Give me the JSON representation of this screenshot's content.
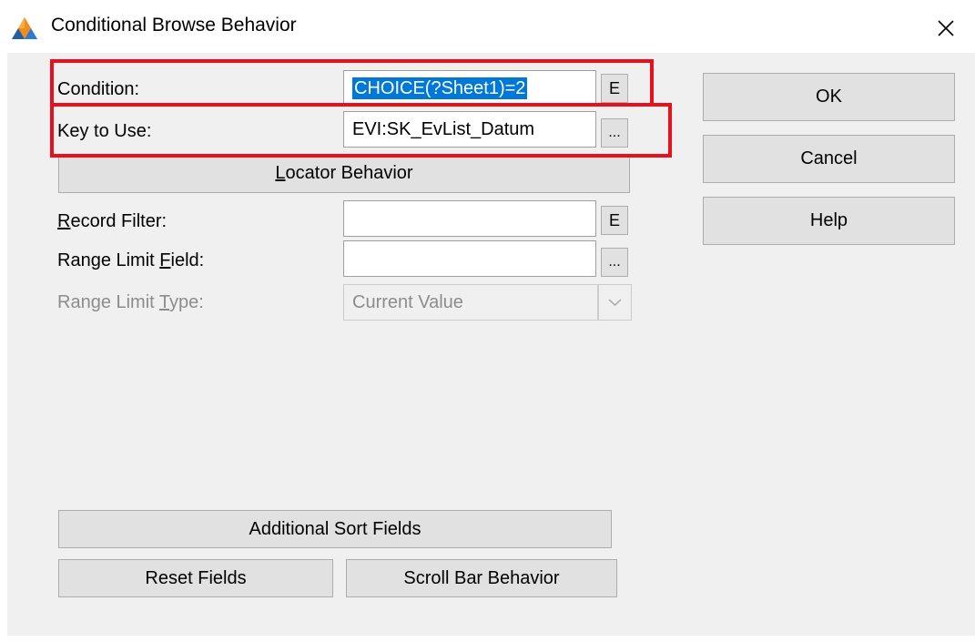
{
  "window": {
    "title": "Conditional Browse Behavior",
    "app_icon": "clarion-triangle-icon",
    "close_glyph": "✕"
  },
  "form": {
    "condition": {
      "label": "Condition:",
      "value": "CHOICE(?Sheet1)=2",
      "button_label": "E"
    },
    "key_to_use": {
      "label": "Key to Use:",
      "value": "EVI:SK_EvList_Datum",
      "button_label": "..."
    },
    "locator_behavior": {
      "label_accel": "L",
      "label_rest": "ocator Behavior"
    },
    "record_filter": {
      "label_accel": "R",
      "label_rest": "ecord Filter:",
      "value": "",
      "button_label": "E"
    },
    "range_limit_field": {
      "label_pre": "Range Limit ",
      "label_accel": "F",
      "label_rest": "ield:",
      "value": "",
      "button_label": "..."
    },
    "range_limit_type": {
      "label_pre": "Range Limit ",
      "label_accel": "T",
      "label_rest": "ype:",
      "selected_value": "Current Value",
      "enabled": false
    }
  },
  "buttons": {
    "ok": "OK",
    "cancel": "Cancel",
    "help": "Help",
    "additional_sort_fields": "Additional Sort Fields",
    "reset_fields": "Reset Fields",
    "scroll_bar_behavior": "Scroll Bar Behavior"
  },
  "colors": {
    "highlight_annotation": "#e8101c",
    "selection": "#0078d7",
    "dialog_background": "#f0f0f0"
  }
}
